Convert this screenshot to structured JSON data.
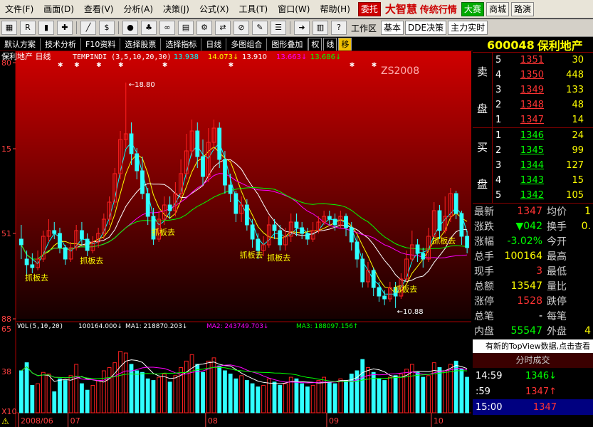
{
  "menubar": {
    "items": [
      "文件(F)",
      "画面(D)",
      "查看(V)",
      "分析(A)",
      "决策(J)",
      "公式(X)",
      "工具(T)",
      "窗口(W)",
      "帮助(H)"
    ],
    "entrust_label": "委托",
    "brand": "大智慧",
    "brand_sub": "传统行情",
    "big_match": "大赛",
    "mall": "商城",
    "roadshow": "路演"
  },
  "toolbar": {
    "icons": [
      "grid-icon",
      "rsi-icon",
      "kline-icon",
      "crosshair-icon",
      "ruler-icon",
      "dollar-icon",
      "traffic-light-icon",
      "tree-icon",
      "binoculars-icon",
      "chart-icon",
      "gear-icon",
      "arrows-icon",
      "slash-icon",
      "pen-icon",
      "menu-icon",
      "arrow-icon",
      "bars-icon",
      "help-icon"
    ],
    "workspace_label": "工作区",
    "workspace_value": "基本",
    "dde_label": "DDE决策",
    "main_force_label": "主力实时"
  },
  "tabs": {
    "items": [
      "默认方案",
      "技术分析",
      "F10资料",
      "选择股票",
      "选择指标",
      "日线",
      "多图组合",
      "图形叠加"
    ],
    "mode_buttons": [
      "权",
      "线",
      "移"
    ]
  },
  "chart_data": {
    "type": "candlestick",
    "title": "保利地产 日线",
    "indicator_label": "TEMPINDI (3,5,10,20,30)",
    "indicator_values": [
      "13.938",
      "14.073↓",
      "13.910",
      "13.663↓",
      "13.686↓"
    ],
    "indicator_colors": [
      "#00ffff",
      "#ffff00",
      "#ffffff",
      "#ff00ff",
      "#00ff00"
    ],
    "watermark": "ZS2008",
    "high_label": "18.80",
    "low_label": "10.88",
    "ylim": [
      10.5,
      19.5
    ],
    "yticks": [
      "80",
      "15",
      "51",
      "88"
    ],
    "annotation_text": "抓板去",
    "annotations": [
      3,
      13,
      26,
      42,
      47,
      70,
      77
    ],
    "x_labels": [
      "2008/06",
      "07",
      "08",
      "09",
      "10"
    ],
    "x_label_index": [
      0,
      9,
      34,
      56,
      75
    ],
    "up_color": "#ff2020",
    "down_color": "#30ffff",
    "ohlc": [
      [
        13.3,
        13.1,
        13.8,
        12.6
      ],
      [
        12.6,
        12.4,
        12.9,
        12.0
      ],
      [
        12.4,
        12.3,
        12.8,
        12.1
      ],
      [
        12.3,
        12.6,
        12.9,
        12.2
      ],
      [
        12.6,
        13.4,
        13.6,
        12.5
      ],
      [
        13.4,
        13.6,
        14.0,
        13.2
      ],
      [
        13.6,
        13.5,
        13.9,
        13.3
      ],
      [
        13.5,
        13.0,
        13.7,
        12.8
      ],
      [
        13.0,
        12.6,
        13.1,
        12.4
      ],
      [
        12.6,
        13.0,
        13.2,
        12.5
      ],
      [
        13.0,
        13.6,
        13.8,
        12.9
      ],
      [
        13.6,
        13.3,
        13.9,
        13.1
      ],
      [
        13.3,
        12.9,
        13.5,
        12.7
      ],
      [
        12.9,
        13.2,
        13.4,
        12.8
      ],
      [
        13.2,
        13.5,
        13.7,
        13.0
      ],
      [
        13.5,
        14.0,
        14.2,
        13.3
      ],
      [
        14.0,
        14.6,
        14.8,
        13.8
      ],
      [
        14.6,
        15.6,
        15.8,
        14.4
      ],
      [
        15.6,
        16.8,
        17.1,
        15.4
      ],
      [
        16.8,
        17.0,
        18.8,
        16.5
      ],
      [
        17.0,
        16.3,
        17.4,
        15.9
      ],
      [
        16.3,
        15.7,
        16.5,
        15.4
      ],
      [
        15.7,
        14.9,
        16.2,
        14.7
      ],
      [
        14.9,
        14.1,
        15.1,
        13.8
      ],
      [
        14.1,
        13.3,
        14.4,
        13.1
      ],
      [
        13.3,
        14.0,
        14.3,
        13.2
      ],
      [
        14.0,
        14.5,
        14.8,
        13.8
      ],
      [
        14.5,
        14.3,
        14.8,
        14.0
      ],
      [
        14.3,
        14.9,
        15.3,
        14.1
      ],
      [
        14.9,
        15.6,
        16.1,
        14.7
      ],
      [
        15.6,
        16.4,
        17.0,
        15.4
      ],
      [
        16.4,
        17.1,
        17.5,
        16.2
      ],
      [
        17.1,
        16.2,
        17.4,
        15.8
      ],
      [
        16.2,
        15.5,
        16.8,
        15.2
      ],
      [
        15.5,
        16.7,
        17.2,
        15.3
      ],
      [
        16.7,
        17.2,
        17.5,
        16.4
      ],
      [
        17.2,
        16.1,
        17.4,
        15.8
      ],
      [
        16.1,
        15.2,
        16.4,
        14.9
      ],
      [
        15.2,
        14.9,
        15.6,
        14.6
      ],
      [
        14.9,
        14.2,
        15.0,
        13.9
      ],
      [
        14.2,
        14.5,
        14.8,
        13.9
      ],
      [
        14.5,
        13.8,
        14.7,
        13.6
      ],
      [
        13.8,
        13.3,
        14.0,
        13.0
      ],
      [
        13.3,
        12.9,
        13.5,
        12.6
      ],
      [
        12.9,
        13.1,
        13.4,
        12.7
      ],
      [
        13.1,
        13.8,
        14.1,
        13.0
      ],
      [
        13.8,
        13.6,
        14.0,
        13.3
      ],
      [
        13.6,
        13.1,
        13.8,
        12.9
      ],
      [
        13.1,
        13.4,
        13.7,
        12.9
      ],
      [
        13.4,
        13.9,
        14.2,
        13.2
      ],
      [
        13.9,
        13.7,
        14.2,
        13.4
      ],
      [
        13.7,
        13.5,
        13.9,
        13.3
      ],
      [
        13.5,
        13.3,
        13.7,
        13.1
      ],
      [
        13.3,
        13.6,
        13.9,
        13.2
      ],
      [
        13.6,
        13.9,
        14.1,
        13.5
      ],
      [
        13.9,
        14.1,
        14.3,
        13.8
      ],
      [
        14.1,
        14.0,
        14.3,
        13.8
      ],
      [
        14.0,
        13.8,
        14.2,
        13.6
      ],
      [
        13.8,
        14.1,
        14.3,
        13.7
      ],
      [
        14.1,
        13.7,
        14.2,
        13.4
      ],
      [
        13.7,
        13.2,
        13.9,
        12.9
      ],
      [
        13.2,
        12.6,
        13.4,
        12.3
      ],
      [
        12.6,
        11.8,
        12.8,
        11.6
      ],
      [
        11.8,
        12.2,
        12.5,
        11.6
      ],
      [
        12.2,
        11.6,
        12.3,
        11.3
      ],
      [
        11.6,
        11.3,
        11.8,
        11.1
      ],
      [
        11.3,
        11.2,
        11.5,
        10.98
      ],
      [
        11.2,
        11.6,
        11.8,
        11.1
      ],
      [
        11.6,
        11.3,
        11.8,
        10.88
      ],
      [
        11.3,
        11.9,
        12.1,
        11.2
      ],
      [
        11.9,
        12.6,
        12.9,
        11.8
      ],
      [
        12.6,
        13.1,
        13.6,
        12.5
      ],
      [
        13.1,
        12.8,
        13.3,
        12.5
      ],
      [
        12.8,
        12.6,
        13.0,
        12.3
      ],
      [
        12.6,
        13.4,
        13.7,
        12.5
      ],
      [
        13.4,
        14.3,
        14.6,
        13.3
      ],
      [
        14.3,
        13.6,
        14.5,
        13.3
      ],
      [
        13.6,
        14.1,
        14.8,
        13.5
      ],
      [
        14.1,
        14.9,
        15.1,
        13.9
      ],
      [
        14.9,
        14.2,
        15.0,
        14.0
      ],
      [
        14.2,
        13.4,
        14.3,
        13.1
      ],
      [
        13.4,
        13.0,
        13.6,
        12.8
      ]
    ],
    "volume": {
      "label": "VOL(5,10,20)",
      "values_text": [
        "100164.000↓",
        "MA1: 218870.203↓",
        "MA2: 243749.703↓",
        "MA3: 188097.156↑"
      ],
      "value_colors": [
        "#ffffff",
        "#ffffff",
        "#ff00ff",
        "#00ff00"
      ],
      "ylim": [
        0,
        520000
      ],
      "yticks": [
        "65",
        "38",
        "X10"
      ],
      "values": [
        260,
        310,
        170,
        180,
        250,
        240,
        130,
        210,
        200,
        230,
        300,
        180,
        140,
        170,
        200,
        260,
        280,
        310,
        380,
        370,
        300,
        260,
        250,
        210,
        200,
        220,
        240,
        190,
        230,
        280,
        320,
        360,
        300,
        250,
        320,
        340,
        290,
        260,
        240,
        210,
        230,
        200,
        180,
        160,
        170,
        210,
        190,
        170,
        180,
        220,
        210,
        180,
        160,
        170,
        200,
        220,
        190,
        180,
        210,
        200,
        240,
        260,
        330,
        280,
        250,
        210,
        200,
        220,
        230,
        240,
        270,
        300,
        250,
        220,
        230,
        310,
        280,
        260,
        300,
        320,
        270,
        220
      ]
    }
  },
  "quote": {
    "code": "600048",
    "name": "保利地产",
    "sell_label": [
      "卖",
      "盘"
    ],
    "buy_label": [
      "买",
      "盘"
    ],
    "asks": [
      {
        "lvl": "5",
        "price": "1351",
        "vol": "30"
      },
      {
        "lvl": "4",
        "price": "1350",
        "vol": "448"
      },
      {
        "lvl": "3",
        "price": "1349",
        "vol": "133"
      },
      {
        "lvl": "2",
        "price": "1348",
        "vol": "48"
      },
      {
        "lvl": "1",
        "price": "1347",
        "vol": "14"
      }
    ],
    "bids": [
      {
        "lvl": "1",
        "price": "1346",
        "vol": "24"
      },
      {
        "lvl": "2",
        "price": "1345",
        "vol": "99"
      },
      {
        "lvl": "3",
        "price": "1344",
        "vol": "127"
      },
      {
        "lvl": "4",
        "price": "1343",
        "vol": "15"
      },
      {
        "lvl": "5",
        "price": "1342",
        "vol": "105"
      }
    ],
    "stats": [
      {
        "l": "最新",
        "v": "1347",
        "vc": "#ff3333",
        "l2": "均价",
        "v2": "1"
      },
      {
        "l": "涨跌",
        "v": "▼042",
        "vc": "#00ff00",
        "l2": "换手",
        "v2": "0."
      },
      {
        "l": "涨幅",
        "v": "-3.02%",
        "vc": "#00ff00",
        "l2": "今开",
        "v2": ""
      },
      {
        "l": "总手",
        "v": "100164",
        "vc": "#ffff00",
        "l2": "最高",
        "v2": ""
      },
      {
        "l": "现手",
        "v": "3",
        "vc": "#ff3333",
        "l2": "最低",
        "v2": ""
      },
      {
        "l": "总额",
        "v": "13547",
        "vc": "#ffff00",
        "l2": "量比",
        "v2": ""
      },
      {
        "l": "涨停",
        "v": "1528",
        "vc": "#ff3333",
        "l2": "跌停",
        "v2": ""
      },
      {
        "l": "总笔",
        "v": "-",
        "vc": "#ffffff",
        "l2": "每笔",
        "v2": ""
      },
      {
        "l": "内盘",
        "v": "55547",
        "vc": "#00ff00",
        "l2": "外盘",
        "v2": "4"
      }
    ],
    "notice": "有新的TopView数据,点击查看",
    "ticks_title": "分时成交",
    "ticks": [
      {
        "t": "14:59",
        "p": "1346↓",
        "c": "g"
      },
      {
        "t": ":59",
        "p": "1347↑",
        "c": "r"
      },
      {
        "t": "15:00",
        "p": "1347",
        "c": "r"
      }
    ]
  }
}
